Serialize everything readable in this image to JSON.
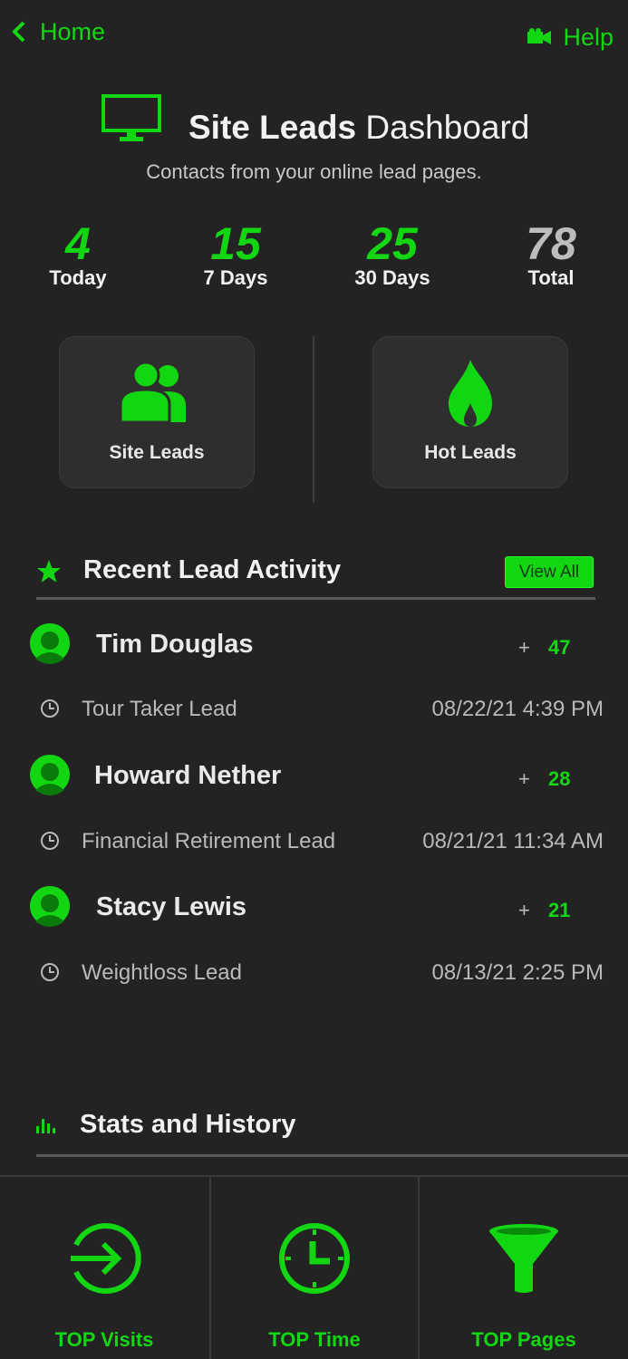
{
  "nav": {
    "home_label": "Home",
    "help_label": "Help"
  },
  "header": {
    "title_bold": "Site Leads",
    "title_rest": "Dashboard",
    "subtitle": "Contacts from your online lead pages."
  },
  "stats": [
    {
      "value": "4",
      "label": "Today"
    },
    {
      "value": "15",
      "label": "7 Days"
    },
    {
      "value": "25",
      "label": "30 Days"
    },
    {
      "value": "78",
      "label": "Total"
    }
  ],
  "tiles": [
    {
      "label": "Site Leads",
      "icon": "users-icon"
    },
    {
      "label": "Hot Leads",
      "icon": "flame-icon"
    }
  ],
  "recent": {
    "title": "Recent Lead Activity",
    "view_all": "View All",
    "leads": [
      {
        "name": "Tim Douglas",
        "plus": "+",
        "score": "47",
        "type": "Tour Taker Lead",
        "date": "08/22/21 4:39 PM"
      },
      {
        "name": "Howard Nether",
        "plus": "+",
        "score": "28",
        "type": "Financial Retirement Lead",
        "date": "08/21/21 11:34 AM"
      },
      {
        "name": "Stacy Lewis",
        "plus": "+",
        "score": "21",
        "type": "Weightloss Lead",
        "date": "08/13/21 2:25 PM"
      }
    ]
  },
  "stats_history": {
    "title": "Stats and History",
    "items": [
      {
        "label": "TOP Visits",
        "icon": "enter-icon"
      },
      {
        "label": "TOP Time",
        "icon": "clock-icon"
      },
      {
        "label": "TOP Pages",
        "icon": "funnel-icon"
      }
    ]
  },
  "colors": {
    "accent": "#13d613",
    "background": "#232323",
    "tile": "#2e2e2e",
    "total": "#bdbdbd"
  }
}
